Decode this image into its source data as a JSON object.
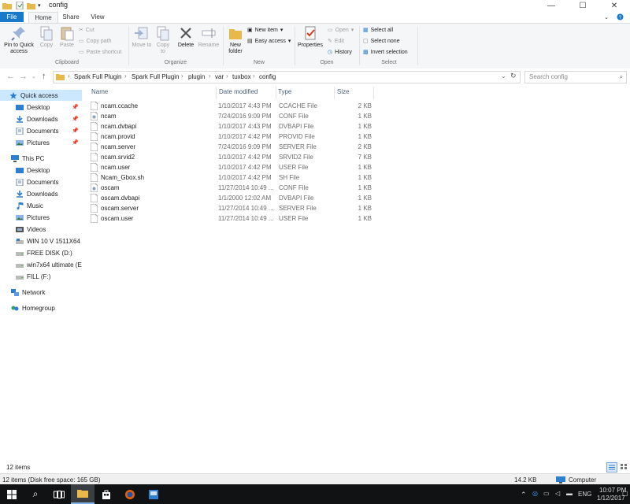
{
  "window": {
    "title": "config"
  },
  "tabs": {
    "file": "File",
    "home": "Home",
    "share": "Share",
    "view": "View"
  },
  "ribbon": {
    "clipboard": {
      "label": "Clipboard",
      "pin": "Pin to Quick access",
      "copy": "Copy",
      "paste": "Paste",
      "cut": "Cut",
      "copy_path": "Copy path",
      "paste_shortcut": "Paste shortcut"
    },
    "organize": {
      "label": "Organize",
      "move_to": "Move to",
      "copy_to": "Copy to",
      "delete": "Delete",
      "rename": "Rename"
    },
    "new": {
      "label": "New",
      "new_folder": "New folder",
      "new_item": "New item",
      "easy_access": "Easy access"
    },
    "open": {
      "label": "Open",
      "properties": "Properties",
      "open": "Open",
      "edit": "Edit",
      "history": "History"
    },
    "select": {
      "label": "Select",
      "select_all": "Select all",
      "select_none": "Select none",
      "invert": "Invert selection"
    }
  },
  "address": {
    "crumbs": [
      "Spark Full Plugin",
      "Spark Full Plugin",
      "plugin",
      "var",
      "tuxbox",
      "config"
    ],
    "search_placeholder": "Search config"
  },
  "nav": {
    "quick_access": "Quick access",
    "quick_items": [
      "Desktop",
      "Downloads",
      "Documents",
      "Pictures"
    ],
    "this_pc": "This PC",
    "pc_items": [
      "Desktop",
      "Documents",
      "Downloads",
      "Music",
      "Pictures",
      "Videos"
    ],
    "drives": [
      "WIN 10 V 1511X64 (C",
      "FREE DISK (D:)",
      "win7x64 ultimate (E:)",
      "FILL (F:)"
    ],
    "network": "Network",
    "homegroup": "Homegroup"
  },
  "columns": {
    "name": "Name",
    "date": "Date modified",
    "type": "Type",
    "size": "Size"
  },
  "files": [
    {
      "name": "ncam.ccache",
      "date": "1/10/2017 4:43 PM",
      "type": "CCACHE File",
      "size": "2 KB"
    },
    {
      "name": "ncam",
      "date": "7/24/2016 9:09 PM",
      "type": "CONF File",
      "size": "1 KB"
    },
    {
      "name": "ncam.dvbapi",
      "date": "1/10/2017 4:43 PM",
      "type": "DVBAPI File",
      "size": "1 KB"
    },
    {
      "name": "ncam.provid",
      "date": "1/10/2017 4:42 PM",
      "type": "PROVID File",
      "size": "1 KB"
    },
    {
      "name": "ncam.server",
      "date": "7/24/2016 9:09 PM",
      "type": "SERVER File",
      "size": "2 KB"
    },
    {
      "name": "ncam.srvid2",
      "date": "1/10/2017 4:42 PM",
      "type": "SRVID2 File",
      "size": "7 KB"
    },
    {
      "name": "ncam.user",
      "date": "1/10/2017 4:42 PM",
      "type": "USER File",
      "size": "1 KB"
    },
    {
      "name": "Ncam_Gbox.sh",
      "date": "1/10/2017 4:42 PM",
      "type": "SH File",
      "size": "1 KB"
    },
    {
      "name": "oscam",
      "date": "11/27/2014 10:49 ...",
      "type": "CONF File",
      "size": "1 KB"
    },
    {
      "name": "oscam.dvbapi",
      "date": "1/1/2000 12:02 AM",
      "type": "DVBAPI File",
      "size": "1 KB"
    },
    {
      "name": "oscam.server",
      "date": "11/27/2014 10:49 ...",
      "type": "SERVER File",
      "size": "1 KB"
    },
    {
      "name": "oscam.user",
      "date": "11/27/2014 10:49 ...",
      "type": "USER File",
      "size": "1 KB"
    }
  ],
  "status": {
    "items": "12 items",
    "details": "12 items (Disk free space: 165 GB)",
    "size": "14.2 KB",
    "location": "Computer"
  },
  "taskbar": {
    "time": "10:07 PM",
    "date": "1/12/2017",
    "lang": "ENG"
  },
  "colors": {
    "accent": "#1979ca",
    "selected": "#cce8ff",
    "folder": "#e8b84a"
  }
}
